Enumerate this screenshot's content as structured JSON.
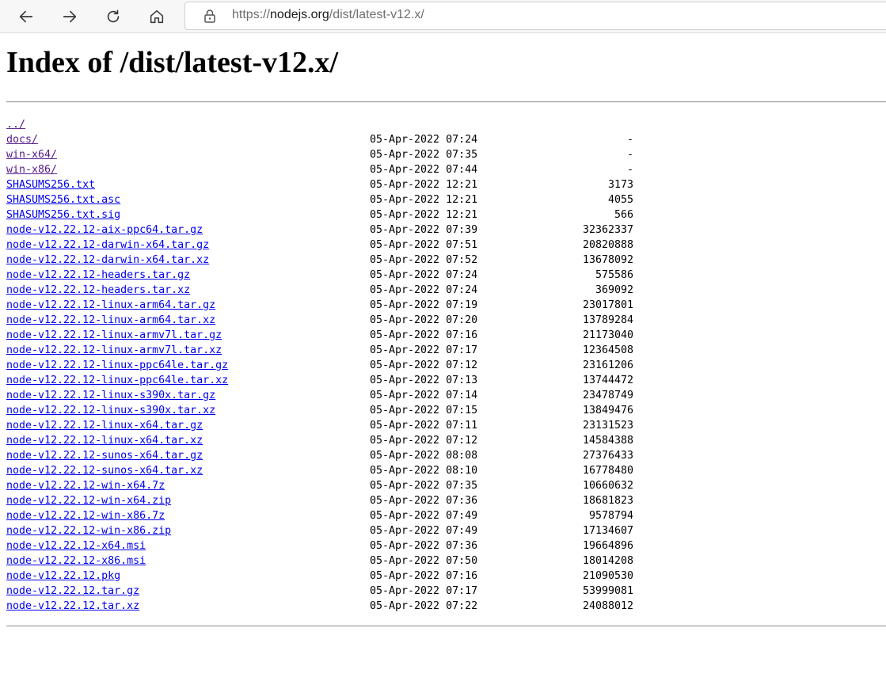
{
  "browser": {
    "url_scheme": "https://",
    "url_host": "nodejs.org",
    "url_path": "/dist/latest-v12.x/"
  },
  "page": {
    "title": "Index of /dist/latest-v12.x/"
  },
  "entries": [
    {
      "name": "../",
      "date": "",
      "size": "",
      "visited": true
    },
    {
      "name": "docs/",
      "date": "05-Apr-2022 07:24",
      "size": "-",
      "visited": true
    },
    {
      "name": "win-x64/",
      "date": "05-Apr-2022 07:35",
      "size": "-",
      "visited": true
    },
    {
      "name": "win-x86/",
      "date": "05-Apr-2022 07:44",
      "size": "-",
      "visited": true
    },
    {
      "name": "SHASUMS256.txt",
      "date": "05-Apr-2022 12:21",
      "size": "3173",
      "visited": false
    },
    {
      "name": "SHASUMS256.txt.asc",
      "date": "05-Apr-2022 12:21",
      "size": "4055",
      "visited": false
    },
    {
      "name": "SHASUMS256.txt.sig",
      "date": "05-Apr-2022 12:21",
      "size": "566",
      "visited": false
    },
    {
      "name": "node-v12.22.12-aix-ppc64.tar.gz",
      "date": "05-Apr-2022 07:39",
      "size": "32362337",
      "visited": false
    },
    {
      "name": "node-v12.22.12-darwin-x64.tar.gz",
      "date": "05-Apr-2022 07:51",
      "size": "20820888",
      "visited": false
    },
    {
      "name": "node-v12.22.12-darwin-x64.tar.xz",
      "date": "05-Apr-2022 07:52",
      "size": "13678092",
      "visited": false
    },
    {
      "name": "node-v12.22.12-headers.tar.gz",
      "date": "05-Apr-2022 07:24",
      "size": "575586",
      "visited": false
    },
    {
      "name": "node-v12.22.12-headers.tar.xz",
      "date": "05-Apr-2022 07:24",
      "size": "369092",
      "visited": false
    },
    {
      "name": "node-v12.22.12-linux-arm64.tar.gz",
      "date": "05-Apr-2022 07:19",
      "size": "23017801",
      "visited": false
    },
    {
      "name": "node-v12.22.12-linux-arm64.tar.xz",
      "date": "05-Apr-2022 07:20",
      "size": "13789284",
      "visited": false
    },
    {
      "name": "node-v12.22.12-linux-armv7l.tar.gz",
      "date": "05-Apr-2022 07:16",
      "size": "21173040",
      "visited": false
    },
    {
      "name": "node-v12.22.12-linux-armv7l.tar.xz",
      "date": "05-Apr-2022 07:17",
      "size": "12364508",
      "visited": false
    },
    {
      "name": "node-v12.22.12-linux-ppc64le.tar.gz",
      "date": "05-Apr-2022 07:12",
      "size": "23161206",
      "visited": false
    },
    {
      "name": "node-v12.22.12-linux-ppc64le.tar.xz",
      "date": "05-Apr-2022 07:13",
      "size": "13744472",
      "visited": false
    },
    {
      "name": "node-v12.22.12-linux-s390x.tar.gz",
      "date": "05-Apr-2022 07:14",
      "size": "23478749",
      "visited": false
    },
    {
      "name": "node-v12.22.12-linux-s390x.tar.xz",
      "date": "05-Apr-2022 07:15",
      "size": "13849476",
      "visited": false
    },
    {
      "name": "node-v12.22.12-linux-x64.tar.gz",
      "date": "05-Apr-2022 07:11",
      "size": "23131523",
      "visited": false
    },
    {
      "name": "node-v12.22.12-linux-x64.tar.xz",
      "date": "05-Apr-2022 07:12",
      "size": "14584388",
      "visited": false
    },
    {
      "name": "node-v12.22.12-sunos-x64.tar.gz",
      "date": "05-Apr-2022 08:08",
      "size": "27376433",
      "visited": false
    },
    {
      "name": "node-v12.22.12-sunos-x64.tar.xz",
      "date": "05-Apr-2022 08:10",
      "size": "16778480",
      "visited": false
    },
    {
      "name": "node-v12.22.12-win-x64.7z",
      "date": "05-Apr-2022 07:35",
      "size": "10660632",
      "visited": false
    },
    {
      "name": "node-v12.22.12-win-x64.zip",
      "date": "05-Apr-2022 07:36",
      "size": "18681823",
      "visited": false
    },
    {
      "name": "node-v12.22.12-win-x86.7z",
      "date": "05-Apr-2022 07:49",
      "size": "9578794",
      "visited": false
    },
    {
      "name": "node-v12.22.12-win-x86.zip",
      "date": "05-Apr-2022 07:49",
      "size": "17134607",
      "visited": false
    },
    {
      "name": "node-v12.22.12-x64.msi",
      "date": "05-Apr-2022 07:36",
      "size": "19664896",
      "visited": false
    },
    {
      "name": "node-v12.22.12-x86.msi",
      "date": "05-Apr-2022 07:50",
      "size": "18014208",
      "visited": false
    },
    {
      "name": "node-v12.22.12.pkg",
      "date": "05-Apr-2022 07:16",
      "size": "21090530",
      "visited": false
    },
    {
      "name": "node-v12.22.12.tar.gz",
      "date": "05-Apr-2022 07:17",
      "size": "53999081",
      "visited": false
    },
    {
      "name": "node-v12.22.12.tar.xz",
      "date": "05-Apr-2022 07:22",
      "size": "24088012",
      "visited": false
    }
  ],
  "icons": {
    "back": "back-arrow-icon",
    "forward": "forward-arrow-icon",
    "reload": "reload-icon",
    "home": "home-icon",
    "lock": "lock-icon"
  },
  "colors": {
    "link": "#0000ee",
    "visited_link": "#551a8b"
  }
}
